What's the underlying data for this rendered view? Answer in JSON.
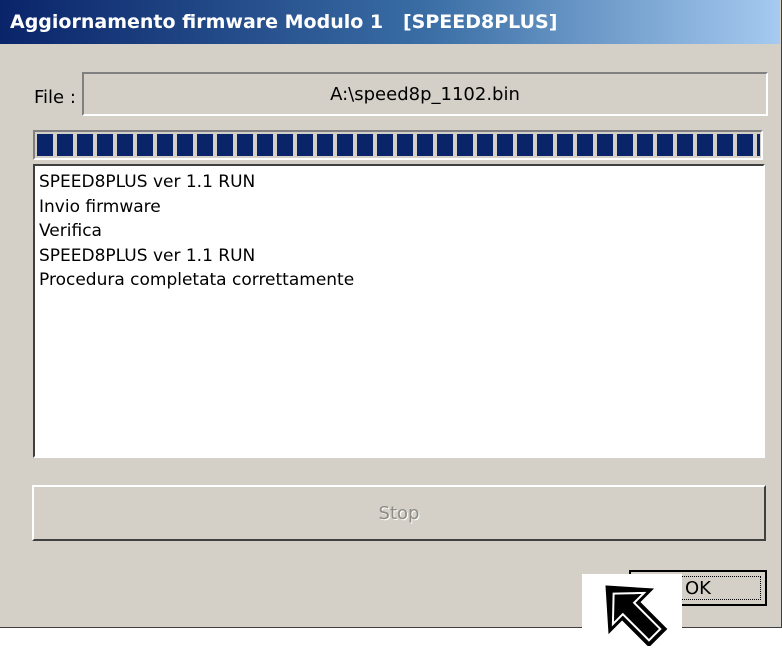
{
  "window": {
    "title": "Aggiornamento firmware Modulo 1   [SPEED8PLUS]"
  },
  "file": {
    "label": "File :",
    "value": "A:\\speed8p_1102.bin"
  },
  "progress": {
    "percent": 100
  },
  "log": {
    "lines": [
      "SPEED8PLUS ver 1.1 RUN",
      "Invio firmware",
      "Verifica",
      "SPEED8PLUS ver 1.1 RUN",
      "Procedura completata correttamente"
    ]
  },
  "buttons": {
    "stop_label": "Stop",
    "ok_label": "OK"
  },
  "icons": {
    "pointer": "arrow-pointer-icon"
  },
  "colors": {
    "title_start": "#0a246a",
    "title_end": "#a6caf0",
    "progress_fill": "#0a246a",
    "dialog_bg": "#d4d0c8"
  }
}
